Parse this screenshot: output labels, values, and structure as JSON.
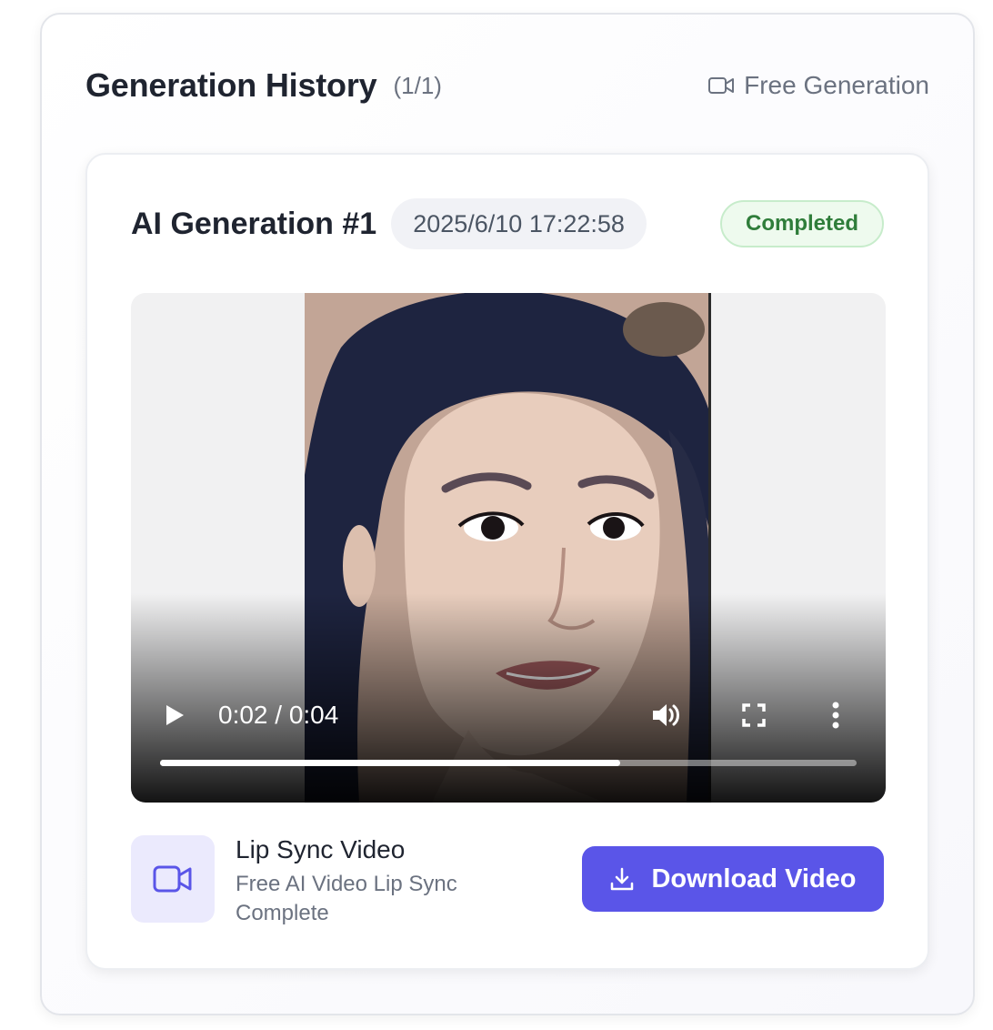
{
  "history": {
    "title": "Generation History",
    "count": "(1/1)",
    "free_label": "Free Generation",
    "free_icon": "video-camera-icon"
  },
  "generation": {
    "title": "AI Generation #1",
    "timestamp": "2025/6/10 17:22:58",
    "status": "Completed",
    "status_colors": {
      "bg": "#eefaee",
      "border": "#c7eccb",
      "text": "#2f7d3a"
    }
  },
  "player": {
    "current_time": "0:02",
    "duration": "0:04",
    "time_display": "0:02 / 0:04",
    "progress_fraction": 0.66,
    "icons": [
      "play-icon",
      "volume-icon",
      "fullscreen-icon",
      "more-vertical-icon"
    ]
  },
  "result": {
    "name": "Lip Sync Video",
    "description": "Free AI Video Lip Sync Complete",
    "icon": "video-camera-icon",
    "download_label": "Download Video",
    "download_icon": "download-icon"
  },
  "colors": {
    "accent": "#5a55e8",
    "accent_soft": "#ebeafd",
    "text_primary": "#1f2430",
    "text_muted": "#6b7280"
  }
}
